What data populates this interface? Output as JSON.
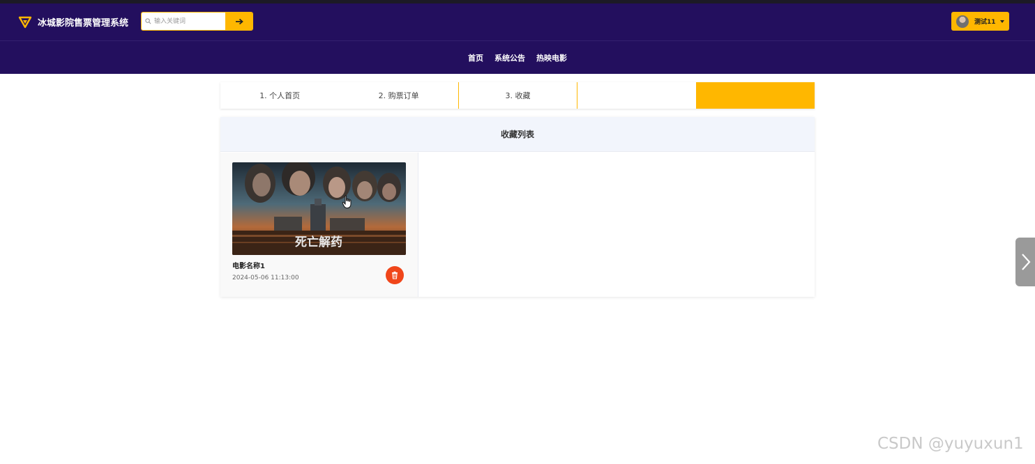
{
  "header": {
    "brand": "冰城影院售票管理系统",
    "search_placeholder": "输入关键词",
    "user_name": "测试11"
  },
  "nav": {
    "items": [
      "首页",
      "系统公告",
      "热映电影"
    ]
  },
  "steps": {
    "items": [
      "1. 个人首页",
      "2. 购票订单",
      "3. 收藏",
      "",
      ""
    ]
  },
  "favorites": {
    "title": "收藏列表",
    "items": [
      {
        "name": "电影名称1",
        "time": "2024-05-06 11:13:00",
        "poster_text": "死亡解药"
      }
    ]
  },
  "watermark": "CSDN @yuyuxun1",
  "colors": {
    "header_bg": "#230f5e",
    "accent": "#ffb700",
    "delete": "#f0461a"
  }
}
